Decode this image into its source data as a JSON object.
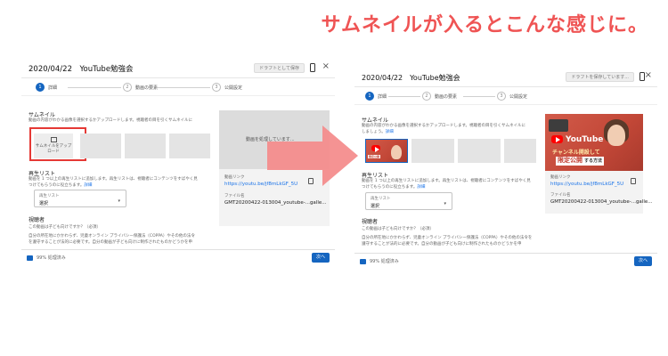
{
  "headline": "サムネイルが入るとこんな感じに。",
  "before": {
    "title": "2020/04/22　YouTube勉強会",
    "draft_button": "ドラフトとして保存",
    "steps": [
      {
        "num": "1",
        "label": "詳細"
      },
      {
        "num": "2",
        "label": "動画の要素"
      },
      {
        "num": "3",
        "label": "公開設定"
      }
    ],
    "thumbnail": {
      "heading": "サムネイル",
      "desc1": "動画の内容がわかる画像を選択するかアップロードします。視聴者の目を引くサムネイルに",
      "upload_label_line1": "サムネイルをアップ",
      "upload_label_line2": "ロード"
    },
    "playlist": {
      "heading": "再生リスト",
      "desc1": "動画を 1 つ以上の再生リストに追加します。再生リストは、視聴者にコンテンツをすばやく見",
      "desc2": "つけてもらうのに役立ちます。",
      "more_link": "詳細",
      "select_label": "再生リスト",
      "select_value": "選択",
      "select_arrow": "▾"
    },
    "audience": {
      "heading": "視聴者",
      "question": "この動画は子ども向けですか？（必須）",
      "desc1": "自分の所在地にかかわらず、児童オンライン プライバシー保護法（COPPA）やその他の法令",
      "desc2": "を遵守することが法的に必要です。自分の動画が子ども向けに制作されたものかどうかを申"
    },
    "preview": {
      "processing": "動画を処理しています...",
      "link_label": "動画リンク",
      "link_url": "https://youtu.be/jf8mLkGF_5U",
      "file_label": "ファイル名",
      "file_name": "GMT20200422-013004_youtube-...galle..."
    },
    "status": "99% 処理済み",
    "next_button": "次へ"
  },
  "after": {
    "title": "2020/04/22　YouTube勉強会",
    "draft_button": "ドラフトを保存しています...",
    "steps": [
      {
        "num": "1",
        "label": "詳細"
      },
      {
        "num": "2",
        "label": "動画の要素"
      },
      {
        "num": "3",
        "label": "公開設定"
      }
    ],
    "thumbnail": {
      "heading": "サムネイル",
      "desc1": "動画の内容がわかる画像を選択するかアップロードします。視聴者の目を引くサムネイルに",
      "desc2": "しましょう。",
      "more_link": "詳細"
    },
    "playlist": {
      "heading": "再生リスト",
      "desc1": "動画を 1 つ以上の再生リストに追加します。再生リストは、視聴者にコンテンツをすばやく見",
      "desc2": "つけてもらうのに役立ちます。",
      "more_link": "詳細",
      "select_label": "再生リスト",
      "select_value": "選択",
      "select_arrow": "▾"
    },
    "audience": {
      "heading": "視聴者",
      "question": "この動画は子ども向けですか？（必須）",
      "desc1": "自分の所在地にかかわらず、児童オンライン プライバシー保護法（COPPA）やその他の法令を",
      "desc2": "遵守することが法的に必要です。自分の動画が子ども向けに制作されたものかどうかを申"
    },
    "preview": {
      "link_label": "動画リンク",
      "link_url": "https://youtu.be/jf8mLkGF_5U",
      "file_label": "ファイル名",
      "file_name": "GMT20200422-013004_youtube-...galle..."
    },
    "thumb_image": {
      "logo": "YouTube",
      "line1": "チャンネル開設して",
      "line2": "限定公開",
      "line2_suffix": "する方法"
    },
    "status": "99% 処理済み",
    "next_button": "次へ"
  },
  "icons": {
    "close": "×",
    "arrow": "right-arrow-icon"
  },
  "colors": {
    "headline": "#ef5454",
    "arrow": "#f48a8a",
    "accent_blue": "#1565c0",
    "link": "#1a73e8",
    "highlight_outline": "#e53935"
  }
}
